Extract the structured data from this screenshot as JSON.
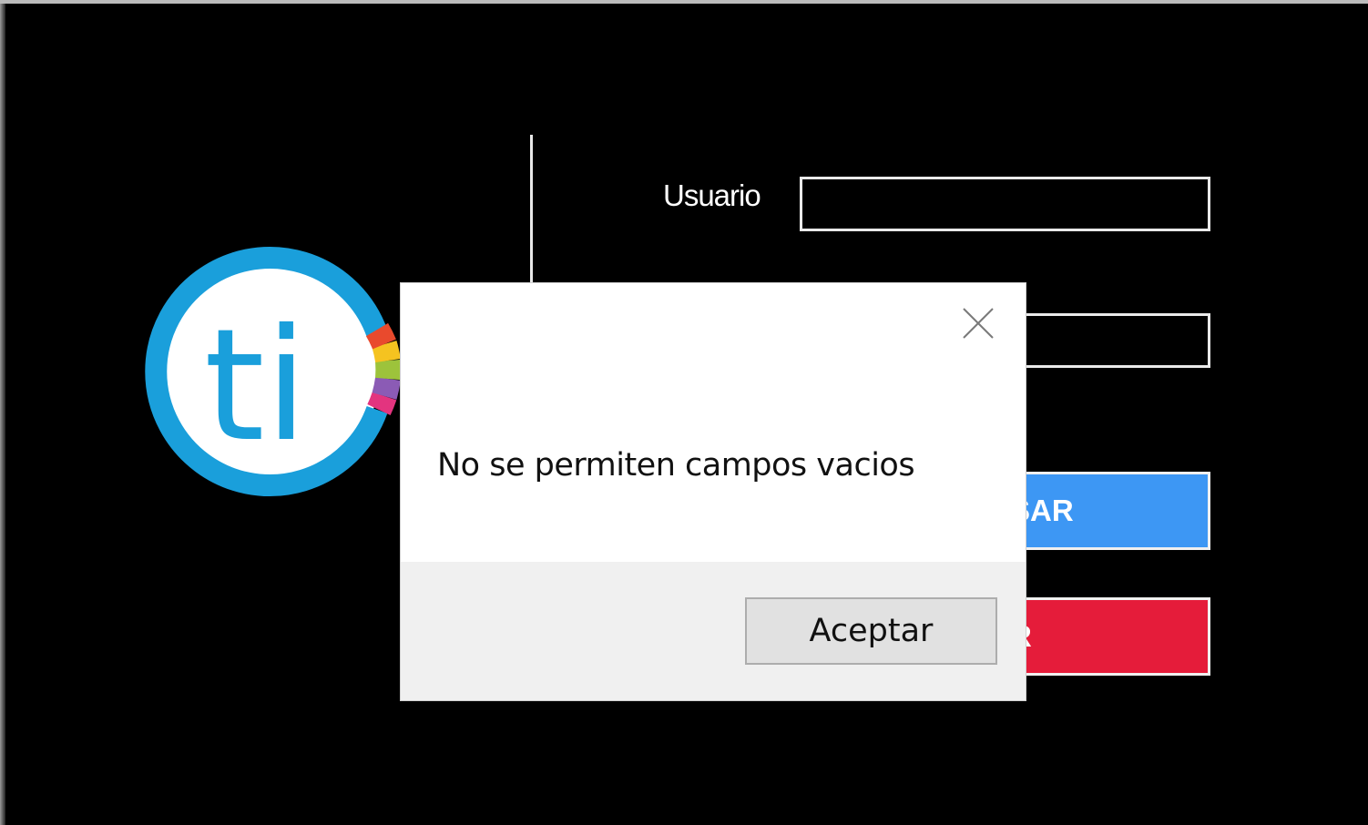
{
  "login_form": {
    "usuario_label": "Usuario",
    "usuario_value": "",
    "password_value": "",
    "ingresar_visible_text": "SAR",
    "salir_visible_text": "R"
  },
  "logo": {
    "text": "ti",
    "color": "#1a9fdb"
  },
  "dialog": {
    "message": "No se permiten campos vacios",
    "ok_label": "Aceptar",
    "close_icon": "close-icon"
  },
  "colors": {
    "background": "#000000",
    "ingresar_button": "#3d97f4",
    "salir_button": "#e51c3a",
    "dialog_background": "#ffffff",
    "dialog_footer": "#f0f0f0"
  }
}
